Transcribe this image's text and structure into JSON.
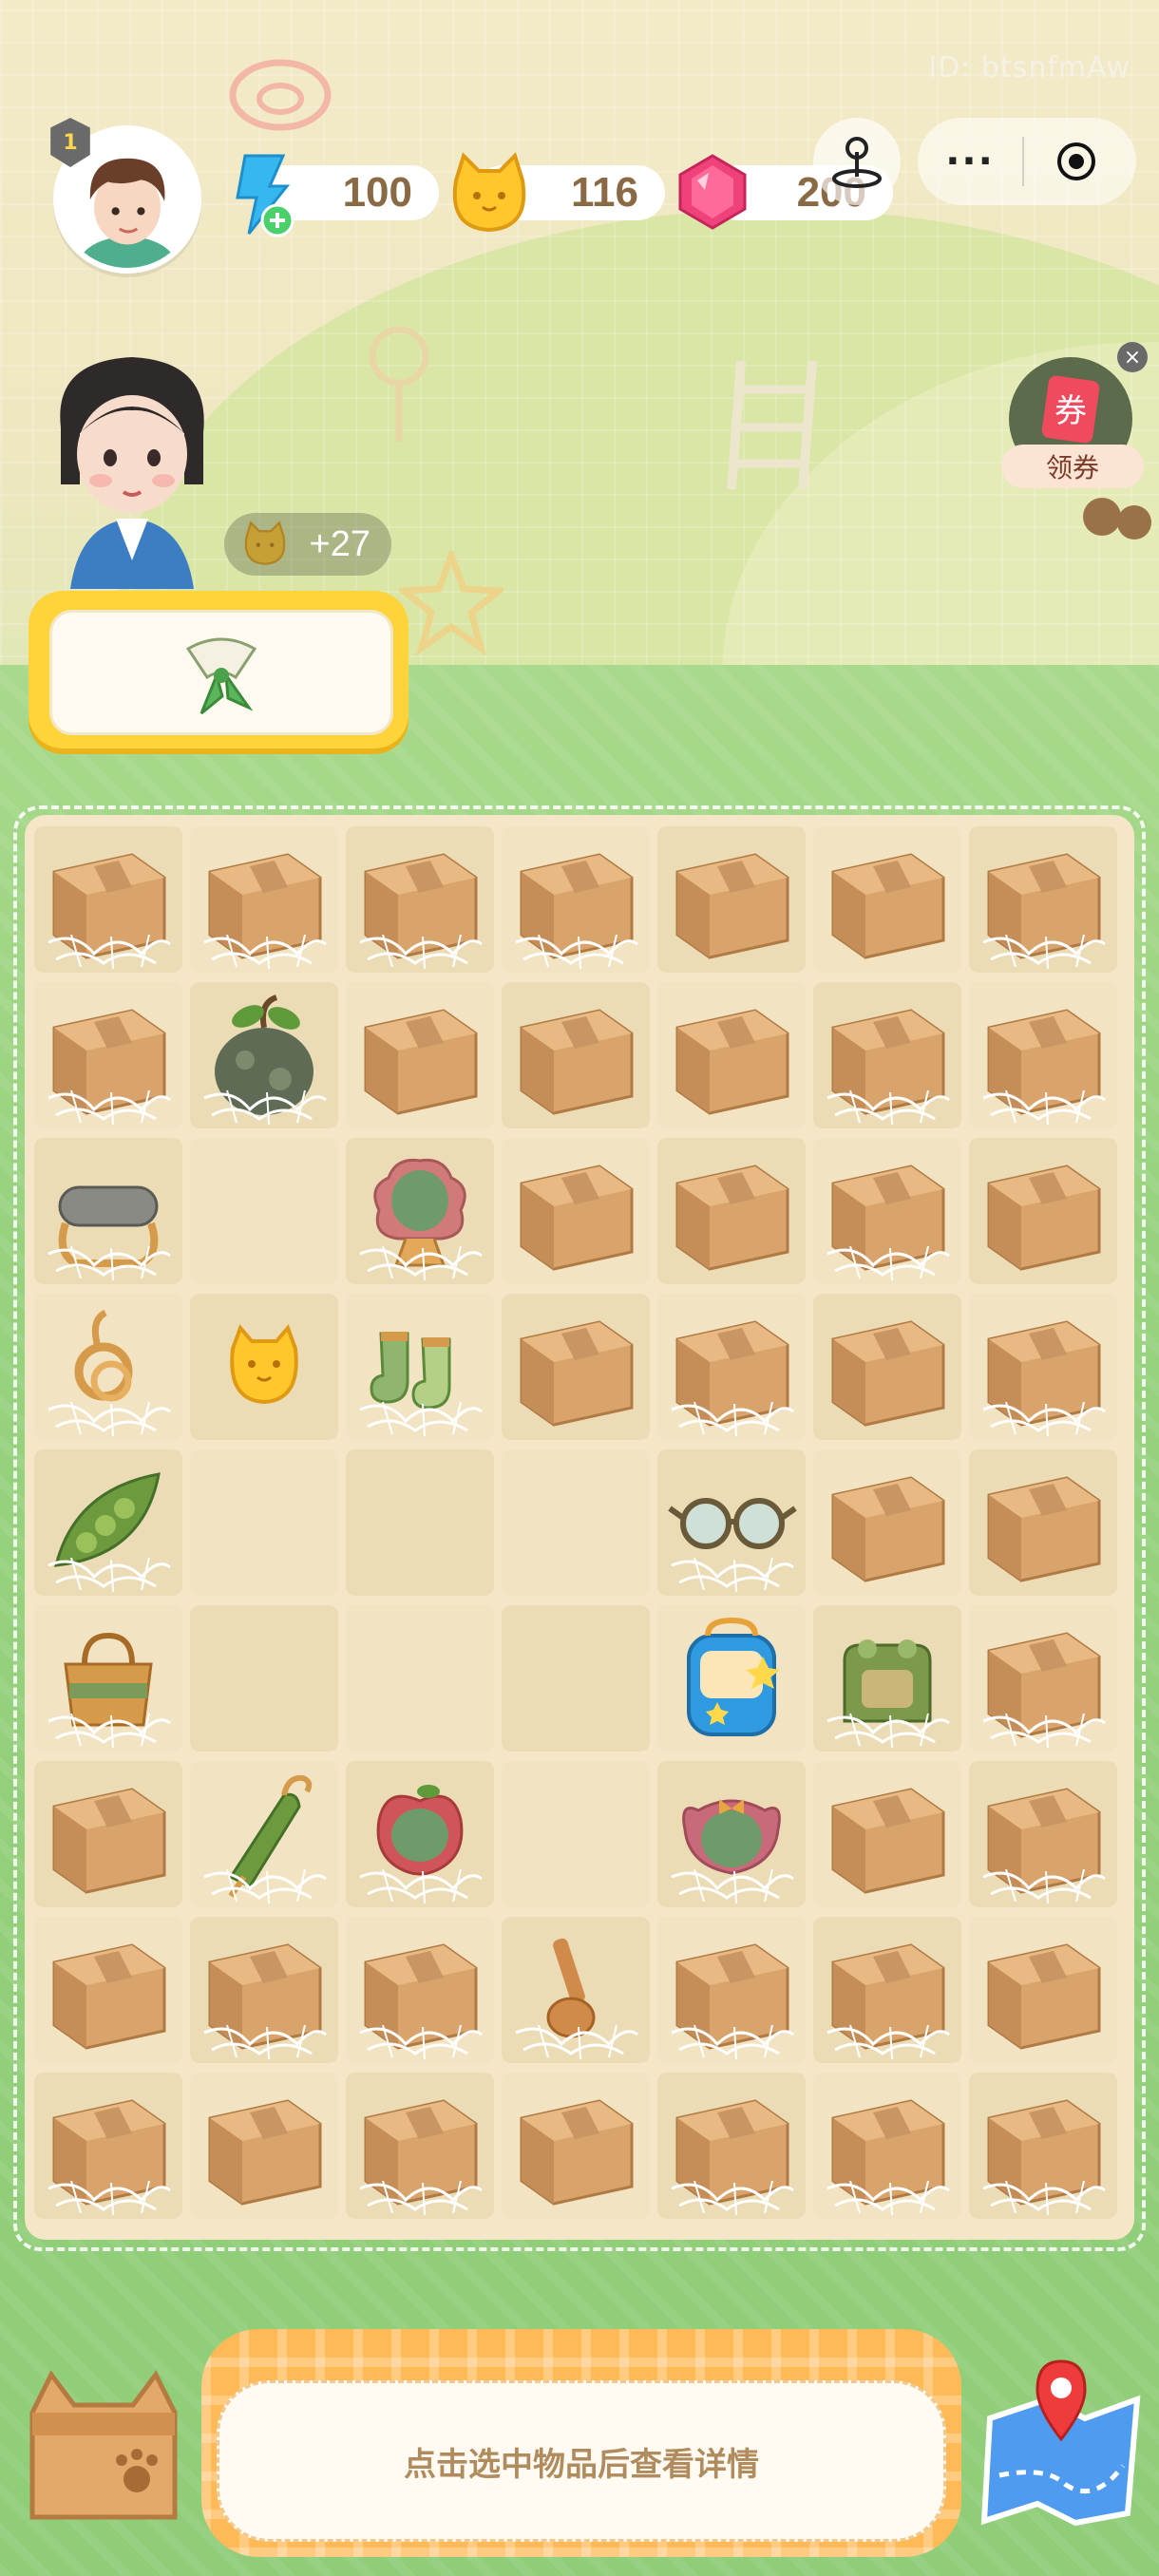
{
  "header": {
    "user_id": "ID: btsnfmAw",
    "level": "1",
    "energy": "100",
    "coins": "116",
    "gems": "200",
    "capsule_more": "···"
  },
  "icons": {
    "energy": "energy-bolt-icon",
    "coin": "cat-coin-icon",
    "gem": "gem-icon",
    "joystick": "joystick-icon",
    "more": "more-dots-icon",
    "close_target": "target-icon"
  },
  "coupon": {
    "badge": "券",
    "label": "领券",
    "close": "×"
  },
  "order": {
    "reward": "+27",
    "requested_item": "scarf"
  },
  "board": {
    "columns": 7,
    "rows": 9,
    "cells": [
      "box-web",
      "box-web",
      "box-web",
      "box-web",
      "box",
      "box",
      "box-web",
      "box-web",
      "clay-pot-web",
      "box",
      "box",
      "box",
      "box-web",
      "box-web",
      "goggles-web",
      "empty",
      "mirror-web",
      "box",
      "box",
      "box-web",
      "box",
      "rope-web",
      "coin",
      "socks-web",
      "box",
      "box-web",
      "box",
      "box-web",
      "peapod-web",
      "empty",
      "empty",
      "empty",
      "glasses-web",
      "box",
      "box",
      "bag-web",
      "empty",
      "empty",
      "empty",
      "backpack",
      "frog-bag-web",
      "box-web",
      "box",
      "umbrella-web",
      "apple-mirror-web",
      "empty",
      "bow-mirror-web",
      "box",
      "box-web",
      "box",
      "box-web",
      "box-web",
      "whistle-web",
      "box-web",
      "box-web",
      "box",
      "box-web",
      "box",
      "box-web",
      "box",
      "box-web",
      "box-web",
      "box-web"
    ]
  },
  "bottom": {
    "hint": "点击选中物品后查看详情"
  },
  "colors": {
    "board_bg": "#f4e6c6",
    "grass": "#98d27f",
    "accent_yellow": "#ffd33a",
    "orange": "#ffb957"
  }
}
